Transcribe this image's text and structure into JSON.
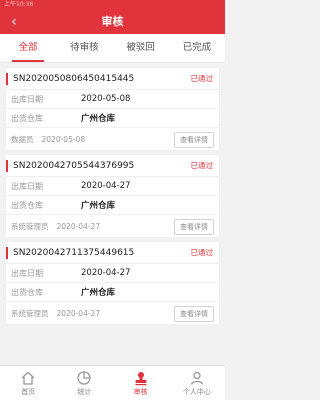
{
  "statusbar": {
    "text": "上午10:36"
  },
  "header": {
    "title": "审核",
    "back": "‹"
  },
  "tabs": [
    {
      "label": "全部"
    },
    {
      "label": "待审核"
    },
    {
      "label": "被驳回"
    },
    {
      "label": "已完成"
    }
  ],
  "orders": [
    {
      "order_no": "SN20200508064504154​45",
      "status": "已通过",
      "out_date_label": "出库日期",
      "out_date": "2020-05-08",
      "warehouse_label": "出货仓库",
      "warehouse": "广州仓库",
      "operator": "数据员",
      "op_date": "2020-05-08",
      "detail_label": "查看详情"
    },
    {
      "order_no": "SN2020042705544376995",
      "status": "已通过",
      "out_date_label": "出库日期",
      "out_date": "2020-04-27",
      "warehouse_label": "出货仓库",
      "warehouse": "广州仓库",
      "operator": "系统管理员",
      "op_date": "2020-04-27",
      "detail_label": "查看详情"
    },
    {
      "order_no": "SN2020042711375449615",
      "status": "已通过",
      "out_date_label": "出库日期",
      "out_date": "2020-04-27",
      "warehouse_label": "出货仓库",
      "warehouse": "广州仓库",
      "operator": "系统管理员",
      "op_date": "2020-04-27",
      "detail_label": "查看详情"
    }
  ],
  "bottom_nav": [
    {
      "label": "首页",
      "icon": "home-icon"
    },
    {
      "label": "统计",
      "icon": "stats-icon"
    },
    {
      "label": "审核",
      "icon": "review-icon"
    },
    {
      "label": "个人中心",
      "icon": "user-icon"
    }
  ],
  "colors": {
    "accent": "#e0333b",
    "background": "#f2f2f2"
  }
}
